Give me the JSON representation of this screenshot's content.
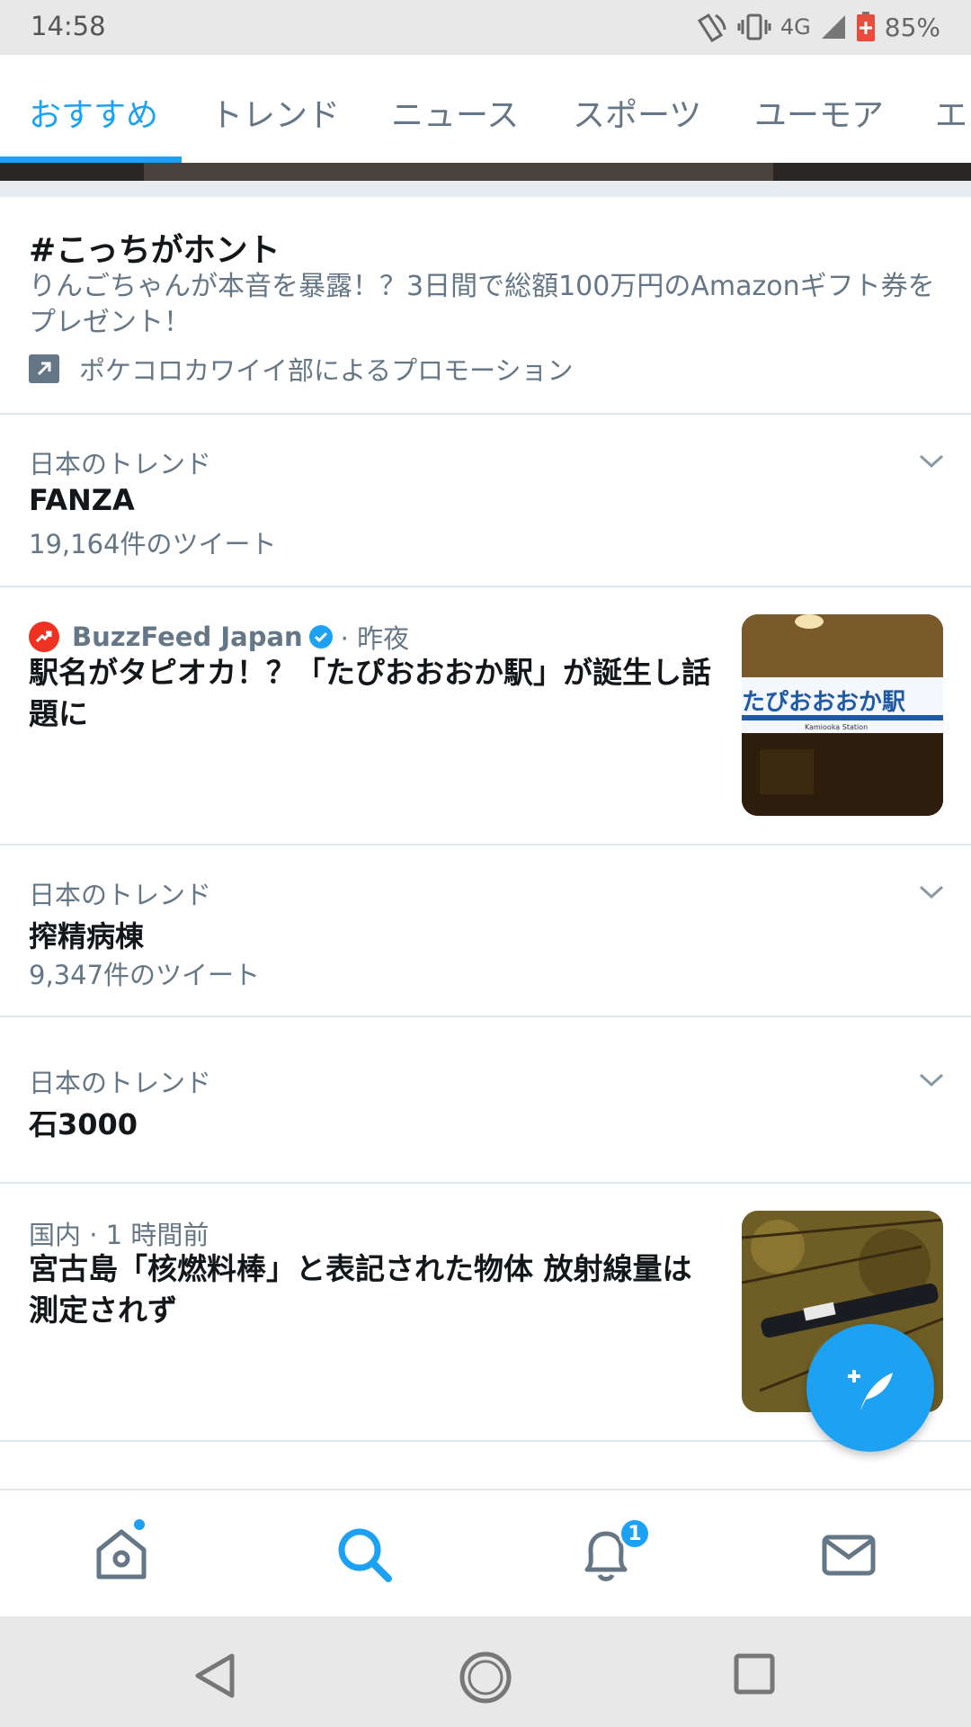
{
  "status_bar": {
    "time": "14:58",
    "network": "4G",
    "battery": "85%"
  },
  "tabs": [
    {
      "label": "おすすめ",
      "active": true
    },
    {
      "label": "トレンド",
      "active": false
    },
    {
      "label": "ニュース",
      "active": false
    },
    {
      "label": "スポーツ",
      "active": false
    },
    {
      "label": "ユーモア",
      "active": false
    },
    {
      "label": "エ",
      "active": false
    }
  ],
  "promo": {
    "title": "#こっちがホント",
    "description": "りんごちゃんが本音を暴露！？3日間で総額100万円のAmazonギフト券をプレゼント！",
    "promoted_by": "ポケコロカワイイ部によるプロモーション",
    "icon": "promoted-arrow-icon"
  },
  "feed": {
    "trend1": {
      "meta": "日本のトレンド",
      "name": "FANZA",
      "count": "19,164件のツイート"
    },
    "news1": {
      "source": "BuzzFeed Japan",
      "time": "· 昨夜",
      "title": "駅名がタピオカ！？「たぴおおおか駅」が誕生し話題に",
      "thumb_sign": "たぴおおおか駅",
      "thumb_sub": "Kamiooka Station"
    },
    "trend2": {
      "meta": "日本のトレンド",
      "name": "搾精病棟",
      "count": "9,347件のツイート"
    },
    "trend3": {
      "meta": "日本のトレンド",
      "name": "石3000"
    },
    "news2": {
      "meta": "国内 · 1 時間前",
      "title": "宮古島「核燃料棒」と表記された物体 放射線量は測定されず"
    }
  },
  "bottom_nav": {
    "items": [
      "home-icon",
      "search-icon",
      "notifications-icon",
      "messages-icon"
    ],
    "active": "search-icon",
    "notification_badge": "1"
  },
  "colors": {
    "accent": "#1da1f2",
    "secondary_text": "#657786",
    "primary_text": "#14171a",
    "divider": "#e1e8ed"
  }
}
